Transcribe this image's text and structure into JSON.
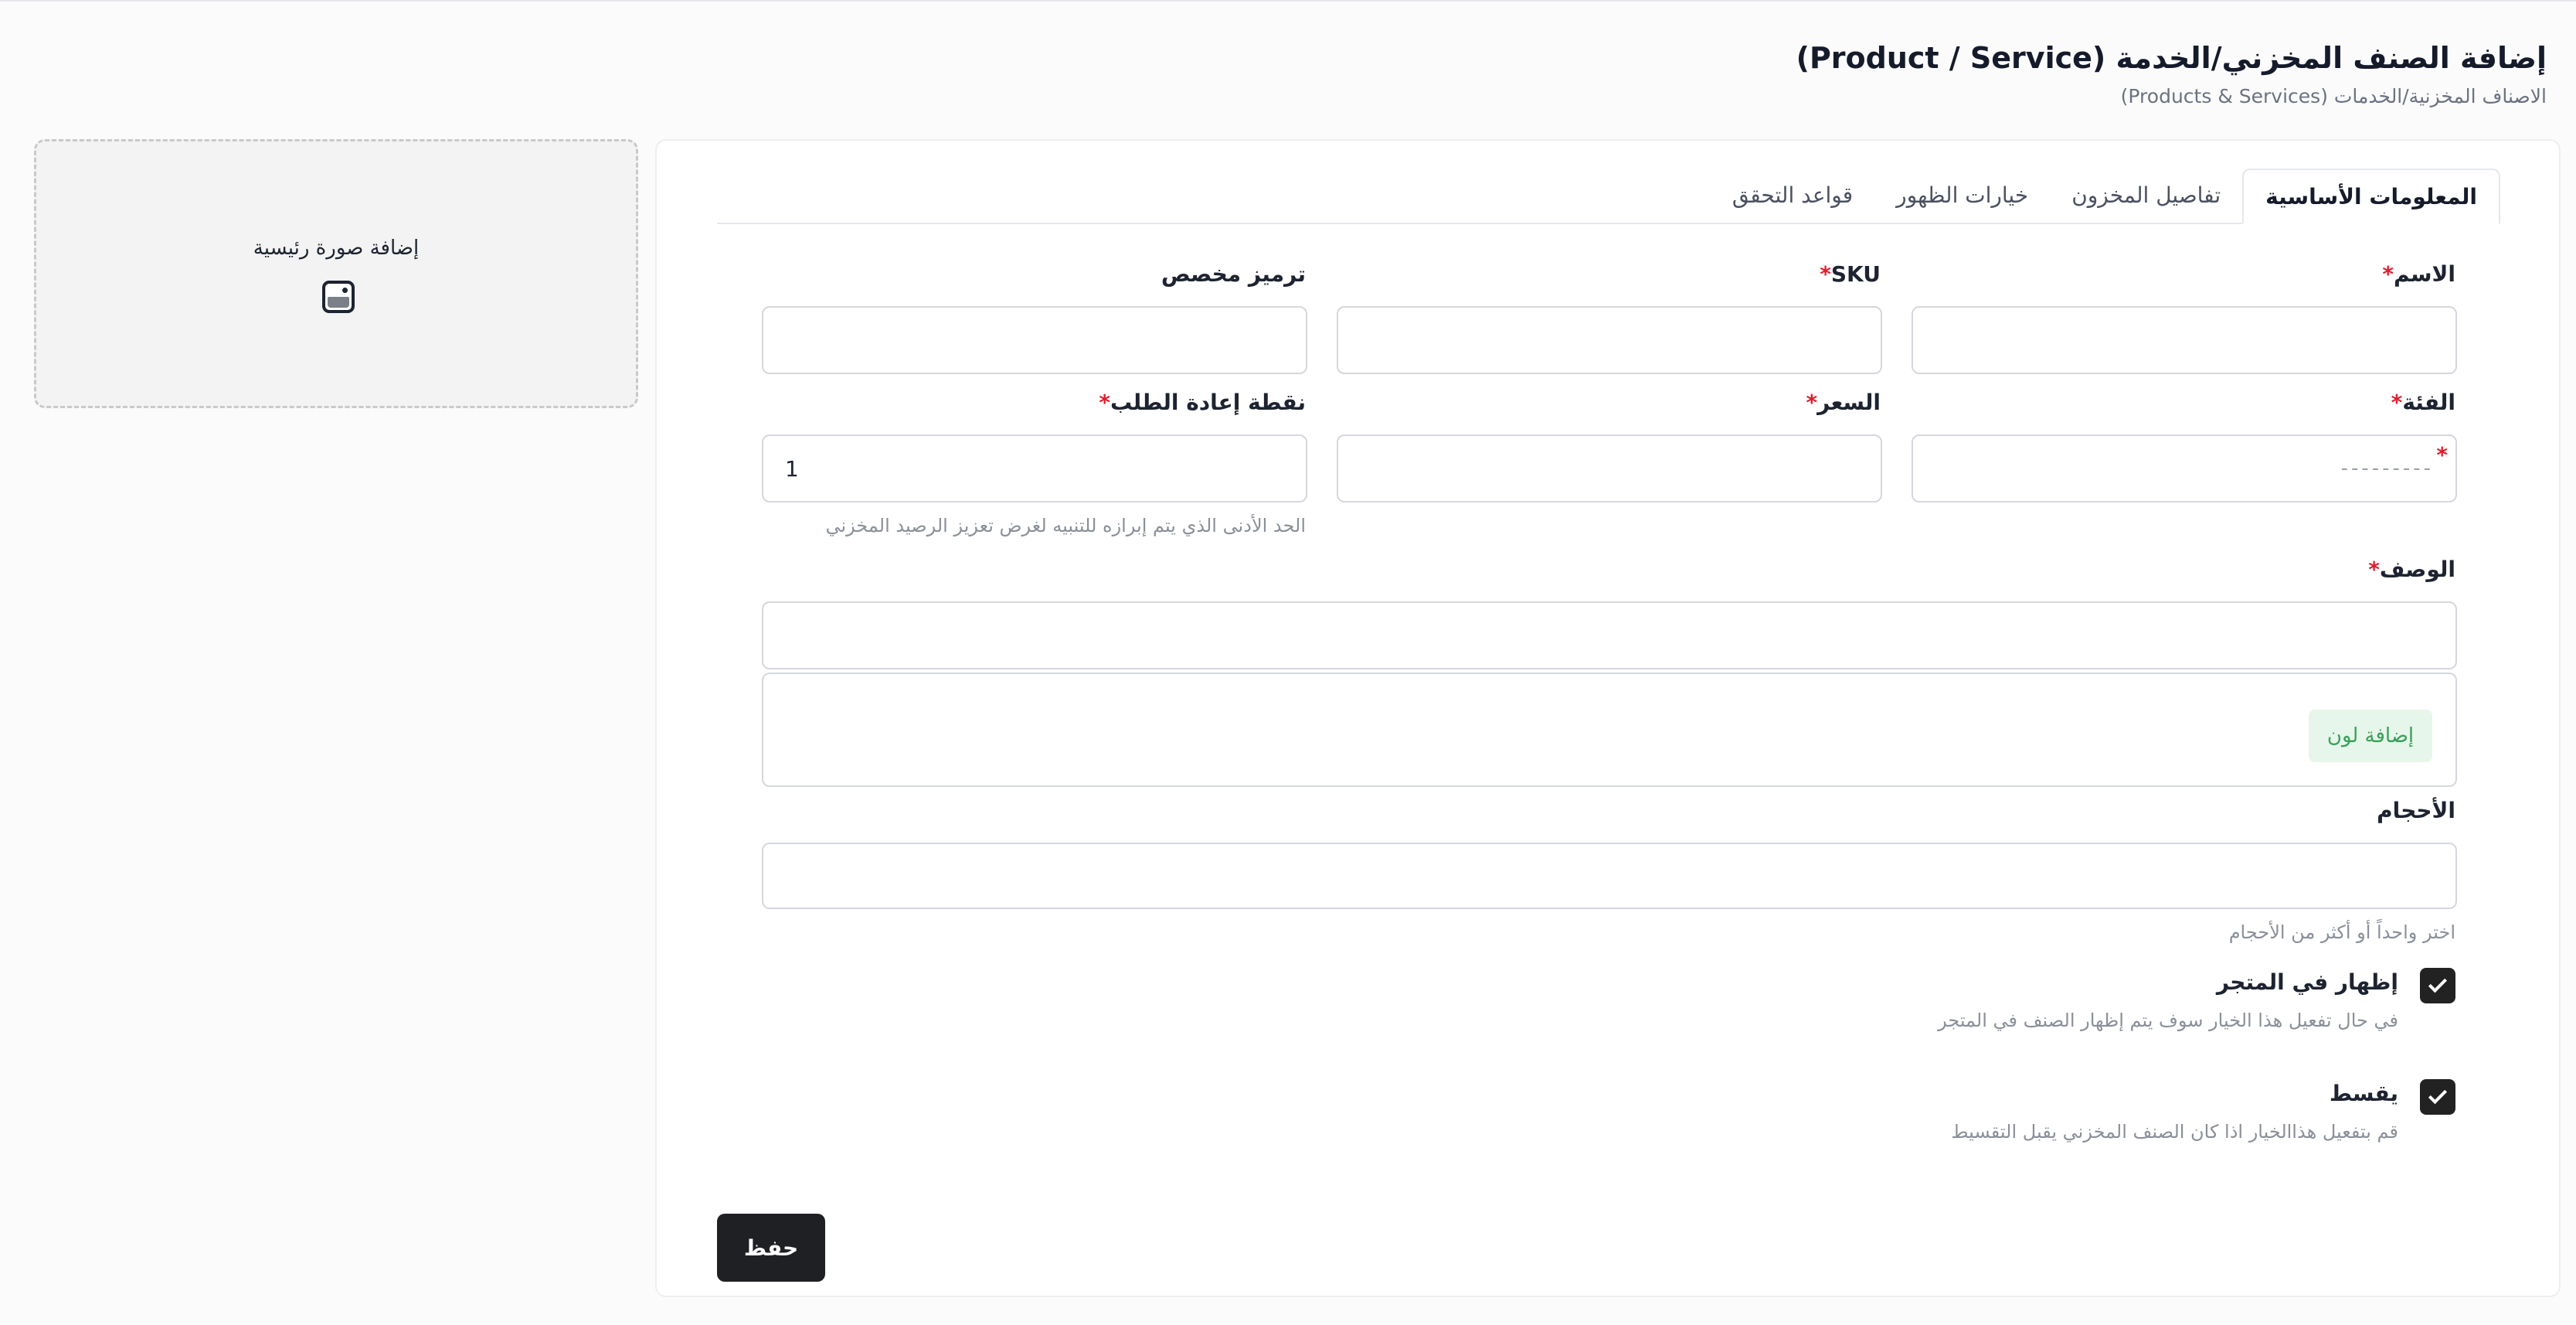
{
  "header": {
    "title": "إضافة الصنف المخزني/الخدمة (Product / Service)",
    "breadcrumb": "الاصناف المخزنية/الخدمات (Products & Services)"
  },
  "image_panel": {
    "label": "إضافة صورة رئيسية",
    "icon": "image-icon"
  },
  "tabs": [
    {
      "label": "المعلومات الأساسية",
      "active": true
    },
    {
      "label": "تفاصيل المخزون",
      "active": false
    },
    {
      "label": "خيارات الظهور",
      "active": false
    },
    {
      "label": "قواعد التحقق",
      "active": false
    }
  ],
  "form": {
    "name": {
      "label": "الاسم",
      "required_mark": "*",
      "value": ""
    },
    "sku": {
      "label": "SKU",
      "required_mark": "*",
      "value": ""
    },
    "custom_code": {
      "label": "ترميز مخصص",
      "value": ""
    },
    "category": {
      "label": "الفئة",
      "required_mark": "*",
      "placeholder": "---------",
      "field_mark": "*"
    },
    "price": {
      "label": "السعر",
      "required_mark": "*",
      "value": ""
    },
    "reorder_point": {
      "label": "نقطة إعادة الطلب",
      "required_mark": "*",
      "value": "1",
      "hint": "الحد الأدنى الذي يتم إبرازه للتنبيه لغرض تعزيز الرصيد المخزني"
    },
    "description": {
      "label": "الوصف",
      "required_mark": "*",
      "value": ""
    },
    "colors": {
      "add_button": "إضافة لون"
    },
    "sizes": {
      "label": "الأحجام",
      "hint": "اختر واحداً أو أكثر من الأحجام"
    },
    "show_in_store": {
      "label": "إظهار في المتجر",
      "checked": true,
      "hint": "في حال تفعيل هذا الخيار سوف يتم إظهار الصنف في المتجر"
    },
    "installment": {
      "label": "يقسط",
      "checked": true,
      "hint": "قم بتفعيل هذاالخيار اذا كان الصنف المخزني يقبل التقسيط"
    }
  },
  "actions": {
    "save": "حفظ"
  },
  "colors": {
    "accent_dark": "#1f2024",
    "required": "#e11d2e",
    "add_color_bg": "#e6f6ea",
    "add_color_text": "#3aa05a"
  }
}
